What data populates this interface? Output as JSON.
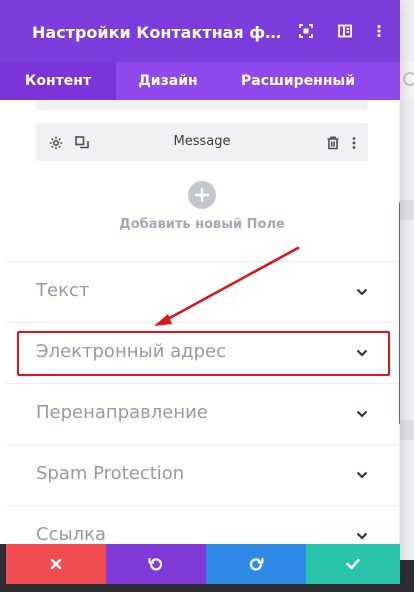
{
  "modal": {
    "title": "Настройки Контактная ф...",
    "header_icons": [
      "fullscreen-icon",
      "split-view-icon",
      "more-vertical-icon"
    ]
  },
  "tabs": [
    {
      "label": "Контент",
      "active": true
    },
    {
      "label": "Дизайн",
      "active": false
    },
    {
      "label": "Расширенный",
      "active": false
    }
  ],
  "field": {
    "label": "Message",
    "icons": [
      "gear-icon",
      "duplicate-icon",
      "trash-icon",
      "more-vertical-icon"
    ]
  },
  "add_field": {
    "icon": "plus-icon",
    "label": "Добавить новый Поле"
  },
  "sections": [
    {
      "label": "Текст"
    },
    {
      "label": "Электронный адрес",
      "highlighted": true
    },
    {
      "label": "Перенаправление"
    },
    {
      "label": "Spam Protection"
    },
    {
      "label": "Ссылка"
    }
  ],
  "footer": {
    "buttons": [
      {
        "name": "cancel",
        "icon": "close-icon",
        "color": "#ef4d52"
      },
      {
        "name": "undo",
        "icon": "undo-icon",
        "color": "#7f3ad8"
      },
      {
        "name": "redo",
        "icon": "redo-icon",
        "color": "#2e8ae6"
      },
      {
        "name": "save",
        "icon": "check-icon",
        "color": "#29c4a9"
      }
    ]
  },
  "colors": {
    "header": "#7c3cdb",
    "tabs": "#8f48ec",
    "annotation": "#e0141a"
  }
}
